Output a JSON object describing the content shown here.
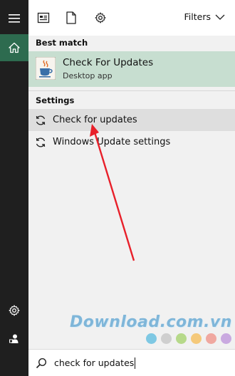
{
  "rail": {
    "items": [
      {
        "icon": "hamburger-menu-icon"
      },
      {
        "icon": "home-icon"
      },
      {
        "icon": "settings-gear-icon"
      },
      {
        "icon": "user-icon"
      }
    ]
  },
  "toolbar": {
    "icons": [
      "documents-icon",
      "document-icon",
      "settings-gear-icon"
    ],
    "filters_label": "Filters"
  },
  "best_match": {
    "label": "Best match",
    "title": "Check For Updates",
    "subtitle": "Desktop app",
    "icon": "java-coffee-icon"
  },
  "settings": {
    "label": "Settings",
    "items": [
      {
        "label": "Check for updates",
        "icon": "refresh-icon",
        "highlighted": true
      },
      {
        "label": "Windows Update settings",
        "icon": "refresh-icon",
        "highlighted": false
      }
    ]
  },
  "watermark": {
    "text": "Download",
    "suffix": ".com.vn",
    "dot_colors": [
      "#7ec8e3",
      "#cfcfcf",
      "#b6d98a",
      "#f5c97a",
      "#f0a8a0",
      "#c9a9e0"
    ]
  },
  "search": {
    "query": "check for updates",
    "icon": "search-icon"
  },
  "colors": {
    "rail_bg": "#1f1f1f",
    "home_active": "#2d6b4f",
    "best_card_bg": "#c7ded0",
    "highlight_row": "#dedede",
    "annotation_arrow": "#e8202a"
  }
}
